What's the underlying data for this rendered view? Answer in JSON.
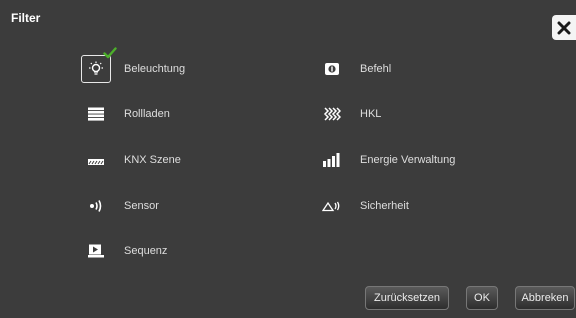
{
  "dialog": {
    "title": "Filter"
  },
  "filters": {
    "left": [
      {
        "label": "Beleuchtung",
        "icon": "lightbulb-icon",
        "selected": true
      },
      {
        "label": "Rollladen",
        "icon": "shutter-icon",
        "selected": false
      },
      {
        "label": "KNX Szene",
        "icon": "scene-icon",
        "selected": false
      },
      {
        "label": "Sensor",
        "icon": "sensor-icon",
        "selected": false
      },
      {
        "label": "Sequenz",
        "icon": "sequence-icon",
        "selected": false
      }
    ],
    "right": [
      {
        "label": "Befehl",
        "icon": "command-icon",
        "selected": false
      },
      {
        "label": "HKL",
        "icon": "hvac-icon",
        "selected": false
      },
      {
        "label": "Energie Verwaltung",
        "icon": "energy-icon",
        "selected": false
      },
      {
        "label": "Sicherheit",
        "icon": "security-icon",
        "selected": false
      }
    ]
  },
  "buttons": {
    "reset": "Zurücksetzen",
    "ok": "OK",
    "cancel": "Abbreken"
  },
  "colors": {
    "background": "#3c3c3c",
    "check": "#4caf2a"
  }
}
